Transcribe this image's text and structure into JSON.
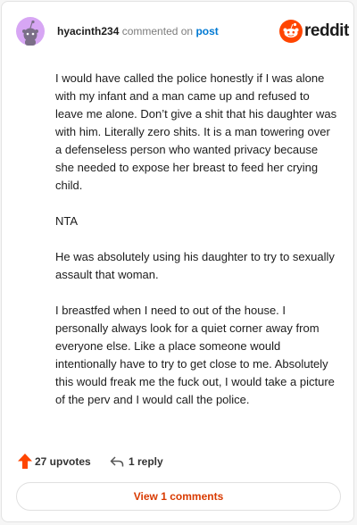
{
  "header": {
    "username": "hyacinth234",
    "commented_on": "commented on",
    "post_link": "post",
    "brand": "reddit"
  },
  "comment": {
    "paragraphs": [
      "I would have called the police honestly if I was alone with my infant and a man came up and refused to leave me alone. Don’t give a shit that his daughter was with him. Literally zero shits. It is a man towering over a defenseless person who wanted privacy because she needed to expose her breast to feed her crying child.",
      "NTA",
      "He was absolutely using his daughter to try to sexually assault that woman.",
      "I breastfed when I need to out of the house. I personally always look for a quiet corner away from everyone else. Like a place someone would intentionally have to try to get close to me. Absolutely this would freak me the fuck out, I would take a picture of the perv and I would call the police."
    ]
  },
  "actions": {
    "upvotes": "27 upvotes",
    "replies": "1 reply"
  },
  "view_comments": "View 1 comments",
  "icons": {
    "avatar": "snoo-avatar-icon",
    "logo": "reddit-logo-icon",
    "upvote": "upvote-arrow-icon",
    "reply": "reply-arrow-icon"
  },
  "colors": {
    "accent": "#ff4500",
    "link": "#0079d3",
    "avatar_bg": "#d7a6f4",
    "view_comments_text": "#d93a00"
  }
}
